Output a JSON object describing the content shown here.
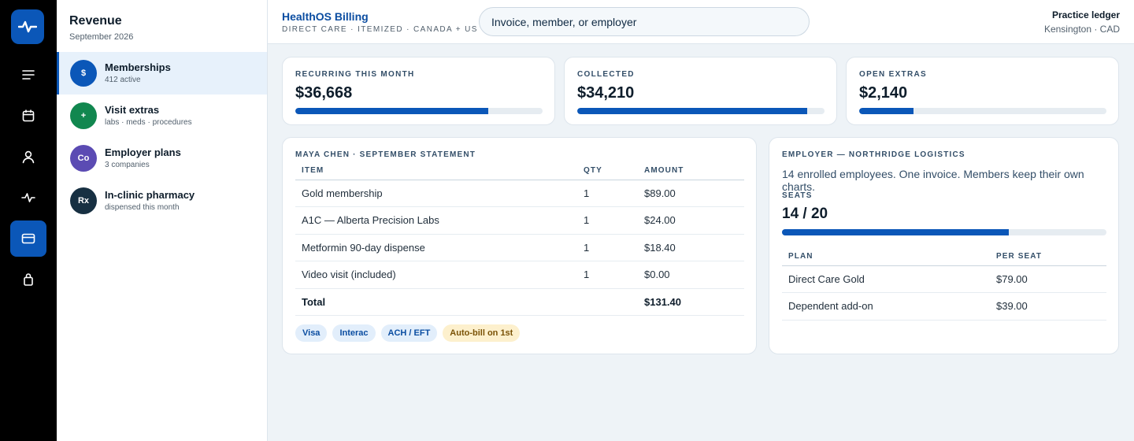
{
  "sidebar": {
    "title": "Revenue",
    "subtitle": "September 2026",
    "items": [
      {
        "badge": "$",
        "badge_color": "#0b57b8",
        "name": "Memberships",
        "meta": "412 active",
        "active": true
      },
      {
        "badge": "+",
        "badge_color": "#11874f",
        "name": "Visit extras",
        "meta": "labs · meds · procedures"
      },
      {
        "badge": "Co",
        "badge_color": "#5b4bb3",
        "name": "Employer plans",
        "meta": "3 companies"
      },
      {
        "badge": "Rx",
        "badge_color": "#173042",
        "name": "In-clinic pharmacy",
        "meta": "dispensed this month"
      }
    ]
  },
  "rail": {
    "icons": [
      "pulse-logo-icon",
      "menu-icon",
      "calendar-icon",
      "person-icon",
      "activity-icon",
      "card-icon",
      "bag-icon"
    ],
    "active": "card-icon"
  },
  "header": {
    "brand": "HealthOS Billing",
    "brand_sub": "Direct care · itemized · Canada + US",
    "search_placeholder": "Invoice, member, or employer",
    "ledger_title": "Practice ledger",
    "ledger_sub": "Kensington · CAD"
  },
  "kpis": [
    {
      "label": "Recurring this month",
      "value": "$36,668",
      "progress": 0.78
    },
    {
      "label": "Collected",
      "value": "$34,210",
      "progress": 0.93
    },
    {
      "label": "Open extras",
      "value": "$2,140",
      "progress": 0.22
    }
  ],
  "statement": {
    "title": "Maya Chen · September statement",
    "columns": [
      "Item",
      "Qty",
      "Amount"
    ],
    "rows": [
      {
        "item": "Gold membership",
        "qty": "1",
        "amount": "$89.00"
      },
      {
        "item": "A1C — Alberta Precision Labs",
        "qty": "1",
        "amount": "$24.00"
      },
      {
        "item": "Metformin 90-day dispense",
        "qty": "1",
        "amount": "$18.40"
      },
      {
        "item": "Video visit (included)",
        "qty": "1",
        "amount": "$0.00"
      }
    ],
    "total_label": "Total",
    "total_amount": "$131.40",
    "payment_methods": [
      "Visa",
      "Interac",
      "ACH / EFT"
    ],
    "autobill": "Auto-bill on 1st"
  },
  "employer": {
    "title": "Employer — Northridge Logistics",
    "description": "14 enrolled employees. One invoice. Members keep their own charts.",
    "seats_label": "Seats",
    "seats_value": "14 / 20",
    "seats_progress": 0.7,
    "columns": [
      "Plan",
      "Per seat"
    ],
    "rows": [
      {
        "plan": "Direct Care Gold",
        "price": "$79.00"
      },
      {
        "plan": "Dependent add-on",
        "price": "$39.00"
      }
    ]
  },
  "colors": {
    "accent": "#0b57b8",
    "rail_bg": "#000000",
    "page_bg": "#eef3f7",
    "autobill_bg": "#fdf0cd"
  }
}
